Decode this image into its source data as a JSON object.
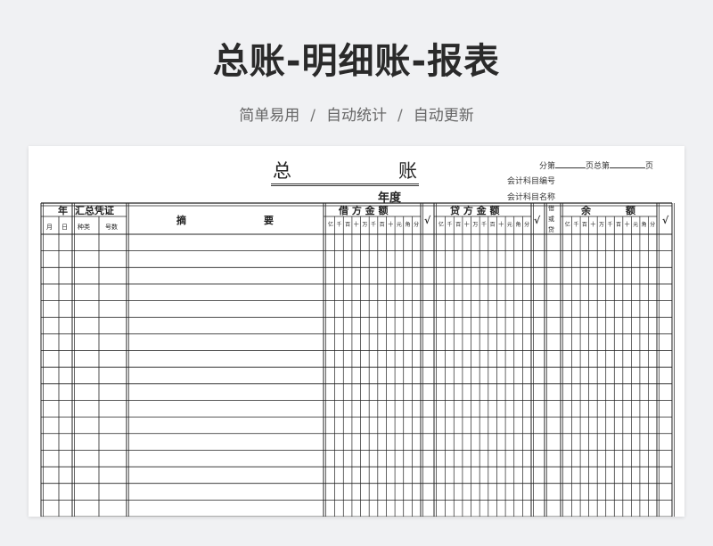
{
  "page": {
    "title": "总账-明细账-报表",
    "subtitle_items": [
      "简单易用",
      "自动统计",
      "自动更新"
    ],
    "subtitle_separator": "/"
  },
  "ledger": {
    "title_char_1": "总",
    "title_char_2": "账",
    "year_label": "年度",
    "meta": {
      "page_prefix": "分第",
      "page_middle": "页总第",
      "page_suffix": "页",
      "account_code": "会计科目编号",
      "account_name": "会计科目名称"
    },
    "headers": {
      "year": "年",
      "month": "月",
      "day": "日",
      "voucher": "汇总凭证",
      "voucher_type": "种类",
      "voucher_number": "号数",
      "summary_1": "摘",
      "summary_2": "要",
      "debit": "借 方 金 额",
      "credit": "贷 方 金 额",
      "check_mark": "√",
      "dr_cr_1": "借",
      "dr_cr_2": "或",
      "dr_cr_3": "贷",
      "balance_1": "余",
      "balance_2": "额",
      "units": [
        "亿",
        "千",
        "百",
        "十",
        "万",
        "千",
        "百",
        "十",
        "元",
        "角",
        "分"
      ]
    },
    "row_count": 17
  }
}
